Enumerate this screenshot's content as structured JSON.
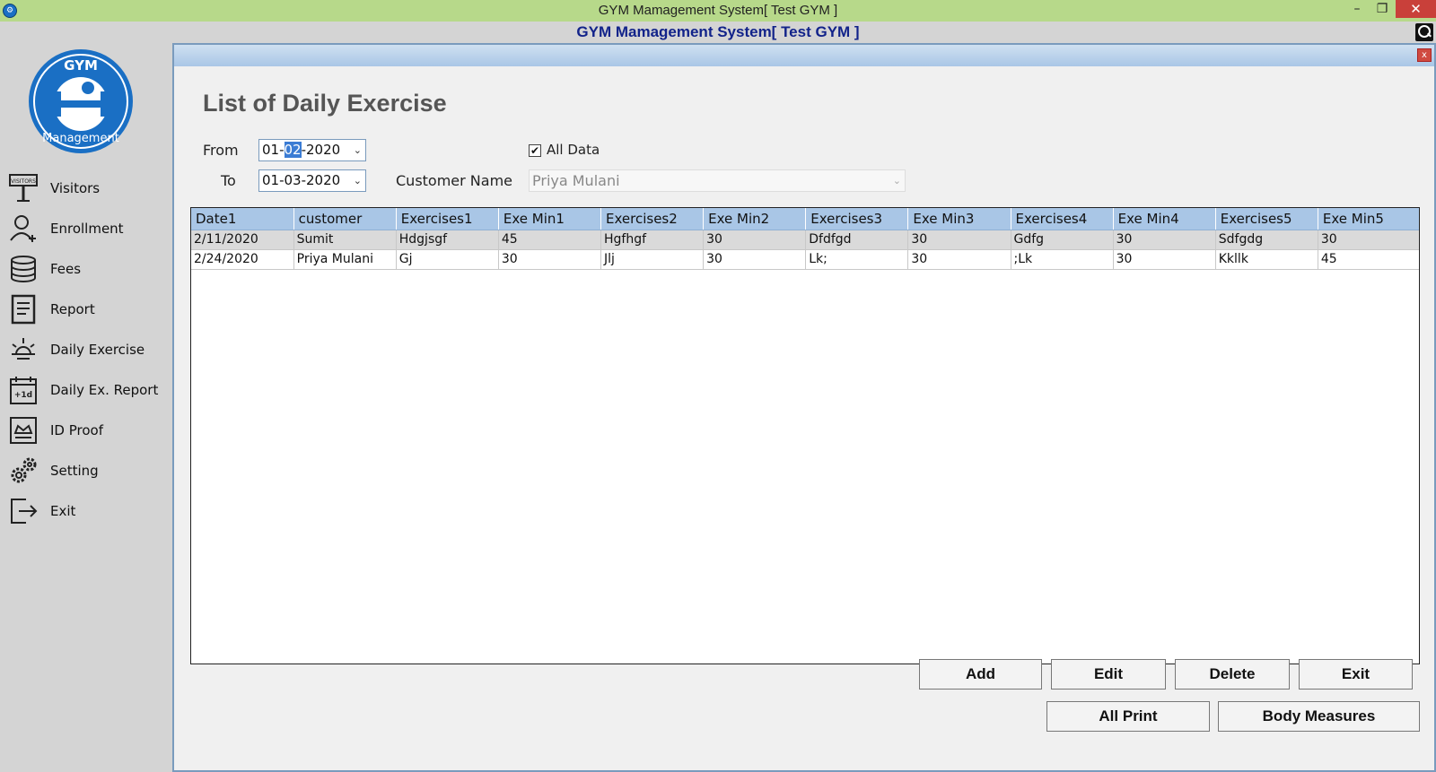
{
  "window": {
    "title": "GYM Mamagement System[ Test GYM ]",
    "minimize": "–",
    "maximize": "❐",
    "close": "✕"
  },
  "mdi": {
    "title": "GYM Mamagement System[ Test GYM ]"
  },
  "logo": {
    "top_text": "GYM",
    "bottom_text": "Management"
  },
  "sidebar": {
    "items": [
      {
        "label": "Visitors",
        "icon": "visitors-sign-icon"
      },
      {
        "label": "Enrollment",
        "icon": "user-add-icon"
      },
      {
        "label": "Fees",
        "icon": "coins-icon"
      },
      {
        "label": "Report",
        "icon": "report-document-icon"
      },
      {
        "label": "Daily Exercise",
        "icon": "sun-icon"
      },
      {
        "label": "Daily Ex. Report",
        "icon": "calendar-plus-icon"
      },
      {
        "label": "ID Proof",
        "icon": "id-card-icon"
      },
      {
        "label": "Setting",
        "icon": "gears-icon"
      },
      {
        "label": "Exit",
        "icon": "exit-door-icon"
      }
    ]
  },
  "form": {
    "title": "List of Daily Exercise",
    "close": "x",
    "from_label": "From",
    "from_value_pre": "01-",
    "from_value_sel": "02",
    "from_value_post": "-2020",
    "to_label": "To",
    "to_value": "01-03-2020",
    "all_data_label": "All Data",
    "all_data_checked": "✔",
    "customer_label": "Customer Name",
    "customer_value": "Priya Mulani"
  },
  "grid": {
    "columns": [
      "Date1",
      "customer",
      "Exercises1",
      "Exe Min1",
      "Exercises2",
      "Exe Min2",
      "Exercises3",
      "Exe Min3",
      "Exercises4",
      "Exe Min4",
      "Exercises5",
      "Exe Min5"
    ],
    "rows": [
      [
        "2/11/2020",
        "Sumit",
        "Hdgjsgf",
        "45",
        "Hgfhgf",
        "30",
        "Dfdfgd",
        "30",
        "Gdfg",
        "30",
        "Sdfgdg",
        "30"
      ],
      [
        "2/24/2020",
        "Priya Mulani",
        "Gj",
        "30",
        "Jlj",
        "30",
        "Lk;",
        "30",
        ";Lk",
        "30",
        "Kkllk",
        "45"
      ]
    ]
  },
  "buttons": {
    "add": "Add",
    "edit": "Edit",
    "delete": "Delete",
    "exit": "Exit",
    "all_print": "All Print",
    "body_measures": "Body Measures"
  },
  "colors": {
    "titlebar": "#b7d98a",
    "header_blue": "#a9c6e6",
    "mdi_title": "#12238a"
  }
}
